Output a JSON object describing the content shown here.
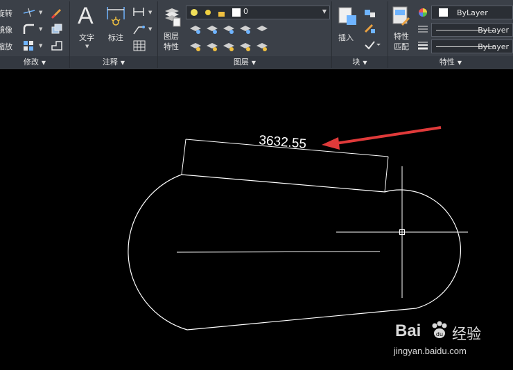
{
  "ribbon": {
    "modify": {
      "rotate": "旋转",
      "mirror": "镜像",
      "scale": "缩放",
      "panel_title": "修改"
    },
    "annotation": {
      "text": "文字",
      "dimension": "标注",
      "panel_title": "注释"
    },
    "layers": {
      "layer_properties": "图层\n特性",
      "current_layer": "0",
      "panel_title": "图层"
    },
    "block": {
      "insert": "插入",
      "panel_title": "块"
    },
    "properties": {
      "match": "特性\n匹配",
      "color": "ByLayer",
      "linetype": "ByLayer",
      "lineweight": "ByLayer",
      "panel_title": "特性"
    }
  },
  "drawing": {
    "dimension_text": "3632.55"
  },
  "watermark": {
    "brand": "Bai",
    "brand_cn": "经验",
    "url": "jingyan.baidu.com"
  },
  "colors": {
    "ribbon_bg": "#3b4048",
    "canvas_bg": "#000000",
    "arrow": "#e03a3a",
    "lines": "#ffffff"
  }
}
